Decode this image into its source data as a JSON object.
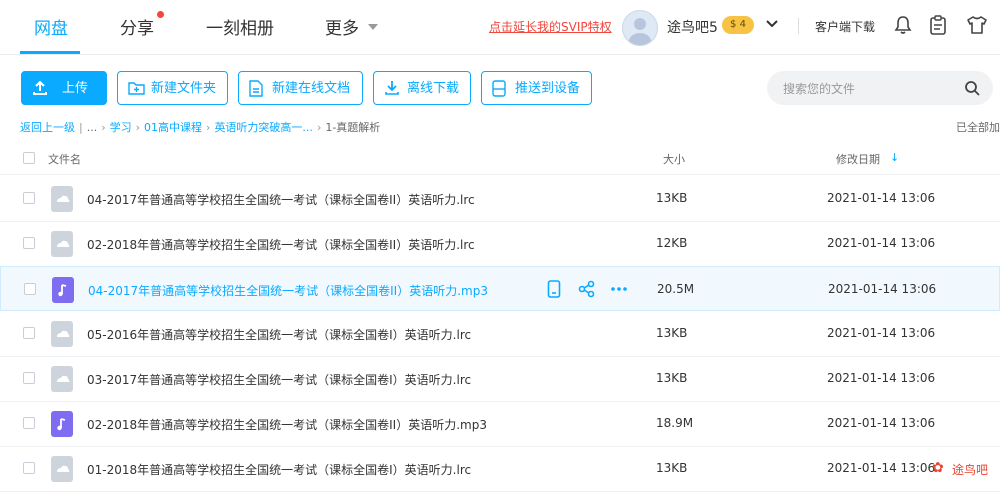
{
  "nav": {
    "items": [
      {
        "label": "网盘",
        "active": true
      },
      {
        "label": "分享"
      },
      {
        "label": "一刻相册"
      },
      {
        "label": "更多"
      }
    ],
    "svip_link": "点击延长我的SVIP特权",
    "username": "途鸟吧5",
    "coin_label": "$ 4",
    "client_download": "客户端下载",
    "accent_color": "#09aaff"
  },
  "toolbar": {
    "upload": "上传",
    "new_folder": "新建文件夹",
    "new_online_doc": "新建在线文档",
    "offline_download": "离线下载",
    "push_to_device": "推送到设备",
    "search_placeholder": "搜索您的文件"
  },
  "breadcrumb": {
    "back": "返回上一级",
    "ellipsis": "...",
    "items": [
      "学习",
      "01高中课程",
      "英语听力突破高一..."
    ],
    "current": "1-真题解析",
    "status": "已全部加"
  },
  "table": {
    "columns": {
      "name": "文件名",
      "size": "大小",
      "date": "修改日期",
      "sort_arrow": "↓"
    },
    "rows": [
      {
        "name": "04-2017年普通高等学校招生全国统一考试（课标全国卷II）英语听力.lrc",
        "size": "13KB",
        "date": "2021-01-14 13:06",
        "type": "lrc"
      },
      {
        "name": "02-2018年普通高等学校招生全国统一考试（课标全国卷II）英语听力.lrc",
        "size": "12KB",
        "date": "2021-01-14 13:06",
        "type": "lrc"
      },
      {
        "name": "04-2017年普通高等学校招生全国统一考试（课标全国卷II）英语听力.mp3",
        "size": "20.5M",
        "date": "2021-01-14 13:06",
        "type": "mp3",
        "hover": true
      },
      {
        "name": "05-2016年普通高等学校招生全国统一考试（课标全国卷I）英语听力.lrc",
        "size": "13KB",
        "date": "2021-01-14 13:06",
        "type": "lrc"
      },
      {
        "name": "03-2017年普通高等学校招生全国统一考试（课标全国卷I）英语听力.lrc",
        "size": "13KB",
        "date": "2021-01-14 13:06",
        "type": "lrc"
      },
      {
        "name": "02-2018年普通高等学校招生全国统一考试（课标全国卷II）英语听力.mp3",
        "size": "18.9M",
        "date": "2021-01-14 13:06",
        "type": "mp3"
      },
      {
        "name": "01-2018年普通高等学校招生全国统一考试（课标全国卷I）英语听力.lrc",
        "size": "13KB",
        "date": "2021-01-14 13:06",
        "type": "lrc"
      }
    ]
  },
  "watermark": {
    "text": "途鸟吧"
  }
}
